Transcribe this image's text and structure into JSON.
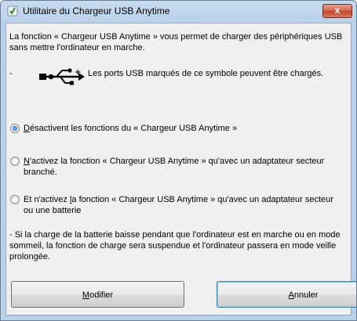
{
  "window": {
    "title": "Utilitaire du Chargeur USB Anytime",
    "close_label": "x"
  },
  "intro": "La fonction « Chargeur USB Anytime » vous permet de charger des périphériques USB sans mettre l'ordinateur en marche.",
  "usb_note": {
    "dash": "-",
    "icon": "usb-icon",
    "text": "Les ports USB marqués de ce symbole peuvent être chargés."
  },
  "options": [
    {
      "accel": "D",
      "rest": "ésactivent les fonctions du « Chargeur USB Anytime »",
      "checked": true
    },
    {
      "accel": "N",
      "rest": "'activez la fonction « Chargeur USB Anytime » qu'avec un adaptateur secteur branché.",
      "checked": false
    },
    {
      "pre": "Et n'activez ",
      "accel": "l",
      "rest": "a fonction « Chargeur USB Anytime » qu'avec un adaptateur secteur ou une batterie",
      "checked": false
    }
  ],
  "note": "- Si la charge de la batterie baisse pendant que l'ordinateur est en marche ou en mode sommeil, la fonction de charge sera suspendue et l'ordinateur passera en mode veille prolongée.",
  "buttons": {
    "modify_accel": "M",
    "modify_rest": "odifier",
    "cancel_accel": "A",
    "cancel_rest": "nnuler"
  }
}
